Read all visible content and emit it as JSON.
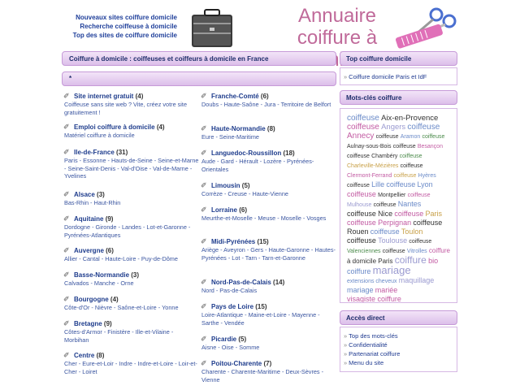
{
  "header": {
    "links": [
      "Nouveaux sites coiffure domicile",
      "Recherche coiffeuse à domicile",
      "Top des sites de coiffure domicile"
    ],
    "title_line1": "Annuaire",
    "title_line2": "coiffure à domicile"
  },
  "main": {
    "heading": "Coiffure à domicile : coiffeuses et coiffeurs à domicile en France",
    "strip_text": "*",
    "left_entries": [
      {
        "title": "Site internet gratuit",
        "count": "(4)",
        "sub": "Coiffeuse sans site web ? Vite, créez votre site gratuitement !"
      },
      {
        "title": "Emploi coiffure à domicile",
        "count": "(4)",
        "sub": "Matériel coiffure à domicile"
      },
      {
        "title": "Ile-de-France",
        "count": "(31)",
        "sub": "Paris - Essonne - Hauts-de-Seine - Seine-et-Marne - Seine-Saint-Denis - Val-d'Oise - Val-de-Marne - Yvelines"
      },
      {
        "title": "Alsace",
        "count": "(3)",
        "sub": "Bas-Rhin - Haut-Rhin"
      },
      {
        "title": "Aquitaine",
        "count": "(9)",
        "sub": "Dordogne - Gironde - Landes - Lot-et-Garonne - Pyrénées-Atlantiques"
      },
      {
        "title": "Auvergne",
        "count": "(6)",
        "sub": "Allier - Cantal - Haute-Loire - Puy-de-Dôme"
      },
      {
        "title": "Basse-Normandie",
        "count": "(3)",
        "sub": "Calvados - Manche - Orne"
      },
      {
        "title": "Bourgogne",
        "count": "(4)",
        "sub": "Côte-d'Or - Nièvre - Saône-et-Loire - Yonne"
      },
      {
        "title": "Bretagne",
        "count": "(9)",
        "sub": "Côtes-d'Armor - Finistère - Ille-et-Vilaine - Morbihan"
      },
      {
        "title": "Centre",
        "count": "(8)",
        "sub": "Cher - Eure-et-Loir - Indre - Indre-et-Loire - Loir-et-Cher - Loiret"
      }
    ],
    "right_entries": [
      {
        "title": "Franche-Comté",
        "count": "(6)",
        "sub": "Doubs - Haute-Saône - Jura - Territoire de Belfort"
      },
      {
        "title": "Haute-Normandie",
        "count": "(8)",
        "sub": "Eure - Seine-Maritime"
      },
      {
        "title": "Languedoc-Roussillon",
        "count": "(18)",
        "sub": "Aude - Gard - Hérault - Lozère - Pyrénées-Orientales"
      },
      {
        "title": "Limousin",
        "count": "(5)",
        "sub": "Corrèze - Creuse - Haute-Vienne"
      },
      {
        "title": "Lorraine",
        "count": "(6)",
        "sub": "Meurthe-et-Moselle - Meuse - Moselle - Vosges"
      },
      {
        "title": "Midi-Pyrénées",
        "count": "(15)",
        "sub": "Ariège - Aveyron - Gers - Haute-Garonne - Hautes-Pyrénées - Lot - Tarn - Tarn-et-Garonne"
      },
      {
        "title": "Nord-Pas-de-Calais",
        "count": "(14)",
        "sub": "Nord - Pas-de-Calais"
      },
      {
        "title": "Pays de Loire",
        "count": "(15)",
        "sub": "Loire-Atlantique - Maine-et-Loire - Mayenne - Sarthe - Vendée"
      },
      {
        "title": "Picardie",
        "count": "(5)",
        "sub": "Aisne - Oise - Somme"
      },
      {
        "title": "Poitou-Charente",
        "count": "(7)",
        "sub": "Charente - Charente-Maritime - Deux-Sèvres - Vienne"
      }
    ]
  },
  "sidebar": {
    "top_heading": "Top coiffure domicile",
    "top_link": "Coiffure domicile Paris et IdF",
    "keywords_heading": "Mots-clés coiffure",
    "keywords": [
      {
        "t": "coiffeuse",
        "c": "#6a8ac8",
        "s": "10px"
      },
      {
        "t": "Aix-en-Provence",
        "c": "#333",
        "s": "9.5px"
      },
      {
        "t": "coiffeuse",
        "c": "#c25aa2",
        "s": "10px"
      },
      {
        "t": "Angers",
        "c": "#9a9ad0",
        "s": "9.5px"
      },
      {
        "t": "coiffeuse",
        "c": "#6a8ac8",
        "s": "10px"
      },
      {
        "t": "Annecy",
        "c": "#c25aa2",
        "s": "10px"
      },
      {
        "t": "coiffeuse",
        "c": "#333",
        "s": "7px"
      },
      {
        "t": "Aramon",
        "c": "#6a8ac8",
        "s": "7px"
      },
      {
        "t": "coiffeuse",
        "c": "#4a8a4a",
        "s": "7px"
      },
      {
        "t": "Aulnay-sous-Bois",
        "c": "#333",
        "s": "7px"
      },
      {
        "t": "coiffeuse",
        "c": "#333",
        "s": "7px"
      },
      {
        "t": "Besançon",
        "c": "#c25aa2",
        "s": "7px"
      },
      {
        "t": "coiffeuse",
        "c": "#333",
        "s": "7px"
      },
      {
        "t": "Chambéry",
        "c": "#333",
        "s": "7px"
      },
      {
        "t": "coiffeuse",
        "c": "#4a8a4a",
        "s": "7px"
      },
      {
        "t": "Charleville-Mézières",
        "c": "#c8a048",
        "s": "7px"
      },
      {
        "t": "coiffeuse",
        "c": "#333",
        "s": "7px"
      },
      {
        "t": "Clermont-Ferrand",
        "c": "#c25aa2",
        "s": "7px"
      },
      {
        "t": "coiffeuse",
        "c": "#c8a048",
        "s": "7px"
      },
      {
        "t": "Hyères",
        "c": "#6a8ac8",
        "s": "7px"
      },
      {
        "t": "coiffeuse",
        "c": "#333",
        "s": "7px"
      },
      {
        "t": "Lille",
        "c": "#6a8ac8",
        "s": "9px"
      },
      {
        "t": "coiffeuse",
        "c": "#6a8ac8",
        "s": "9px"
      },
      {
        "t": "Lyon",
        "c": "#6a8ac8",
        "s": "9px"
      },
      {
        "t": "coiffeuse",
        "c": "#c25aa2",
        "s": "9px"
      },
      {
        "t": "Montpellier",
        "c": "#333",
        "s": "7px"
      },
      {
        "t": "coiffeuse",
        "c": "#c25aa2",
        "s": "7px"
      },
      {
        "t": "Mulhouse",
        "c": "#9a9ad0",
        "s": "7px"
      },
      {
        "t": "coiffeuse",
        "c": "#333",
        "s": "7px"
      },
      {
        "t": "Nantes",
        "c": "#6a8ac8",
        "s": "9px"
      },
      {
        "t": "coiffeuse",
        "c": "#333",
        "s": "9px"
      },
      {
        "t": "Nice",
        "c": "#333",
        "s": "9px"
      },
      {
        "t": "coiffeuse",
        "c": "#c25aa2",
        "s": "9px"
      },
      {
        "t": "Paris",
        "c": "#c8a048",
        "s": "9px"
      },
      {
        "t": "coiffeuse",
        "c": "#c25aa2",
        "s": "9px"
      },
      {
        "t": "Perpignan",
        "c": "#c25aa2",
        "s": "9px"
      },
      {
        "t": "coiffeuse",
        "c": "#333",
        "s": "9px"
      },
      {
        "t": "Rouen",
        "c": "#333",
        "s": "9px"
      },
      {
        "t": "coiffeuse",
        "c": "#6a8ac8",
        "s": "9px"
      },
      {
        "t": "Toulon",
        "c": "#c8a048",
        "s": "9px"
      },
      {
        "t": "coiffeuse",
        "c": "#333",
        "s": "9px"
      },
      {
        "t": "Toulouse",
        "c": "#9a9ad0",
        "s": "9px"
      },
      {
        "t": "coiffeuse",
        "c": "#333",
        "s": "7px"
      },
      {
        "t": "Valenciennes",
        "c": "#4a8a4a",
        "s": "7px"
      },
      {
        "t": "coiffeuse",
        "c": "#333",
        "s": "7px"
      },
      {
        "t": "Vitrolles",
        "c": "#6a8ac8",
        "s": "7px"
      },
      {
        "t": "coiffure",
        "c": "#c25aa2",
        "s": "8px"
      },
      {
        "t": "à domicile Paris",
        "c": "#333",
        "s": "8px"
      },
      {
        "t": "coiffure",
        "c": "#9a9ad0",
        "s": "12px"
      },
      {
        "t": "bio",
        "c": "#c25aa2",
        "s": "9px"
      },
      {
        "t": "coiffure",
        "c": "#6a8ac8",
        "s": "9px"
      },
      {
        "t": "mariage",
        "c": "#9a9ad0",
        "s": "13px"
      },
      {
        "t": "extensions cheveux",
        "c": "#6a8ac8",
        "s": "7px"
      },
      {
        "t": "maquillage",
        "c": "#9a9ad0",
        "s": "9px"
      },
      {
        "t": "mariage",
        "c": "#6a8ac8",
        "s": "9px"
      },
      {
        "t": "mariée",
        "c": "#c25aa2",
        "s": "9px"
      },
      {
        "t": "visagiste coiffure",
        "c": "#c25aa2",
        "s": "9px"
      }
    ],
    "access_heading": "Accès direct",
    "access_links": [
      "Top des mots-clés",
      "Confidentialité",
      "Partenariat coiffure",
      "Menu du site"
    ]
  }
}
